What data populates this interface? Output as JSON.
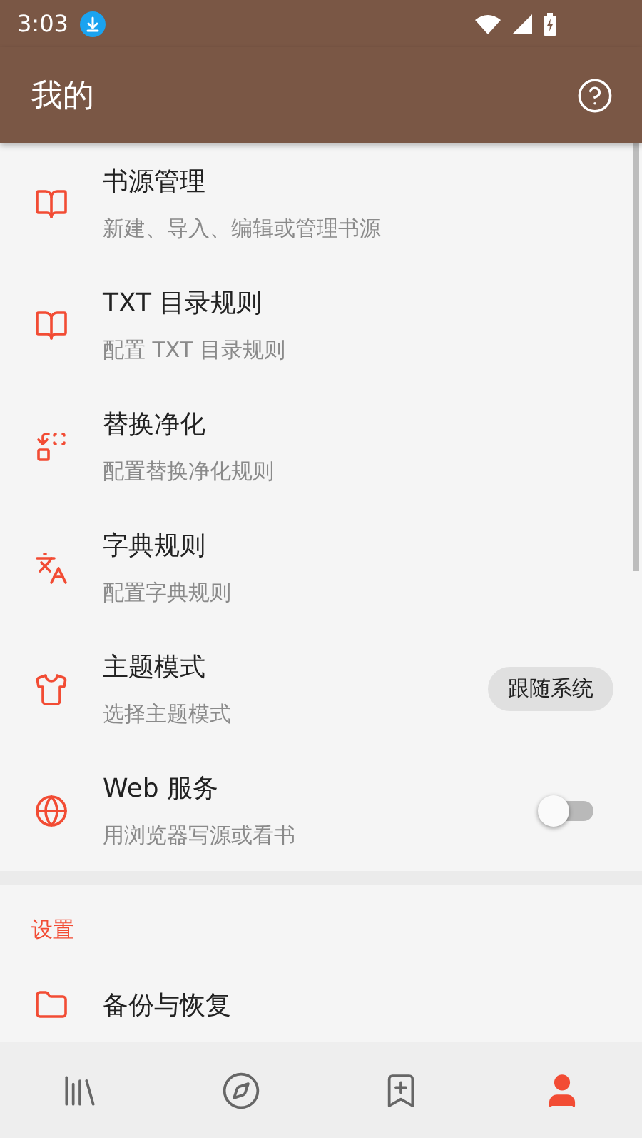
{
  "status_bar": {
    "time": "3:03"
  },
  "toolbar": {
    "title": "我的"
  },
  "items": [
    {
      "kind": "plain",
      "title": "书源管理",
      "subtitle": "新建、导入、编辑或管理书源"
    },
    {
      "kind": "plain",
      "title": "TXT 目录规则",
      "subtitle": "配置 TXT 目录规则"
    },
    {
      "kind": "plain",
      "title": "替换净化",
      "subtitle": "配置替换净化规则"
    },
    {
      "kind": "plain",
      "title": "字典规则",
      "subtitle": "配置字典规则"
    },
    {
      "kind": "chip",
      "title": "主题模式",
      "subtitle": "选择主题模式",
      "value": "跟随系统"
    },
    {
      "kind": "switch",
      "title": "Web 服务",
      "subtitle": "用浏览器写源或看书",
      "on": false
    }
  ],
  "settings": {
    "header": "设置",
    "items": [
      {
        "title": "备份与恢复"
      }
    ]
  },
  "bottom_nav": [
    {
      "selected": false
    },
    {
      "selected": false
    },
    {
      "selected": false
    },
    {
      "selected": true
    }
  ]
}
